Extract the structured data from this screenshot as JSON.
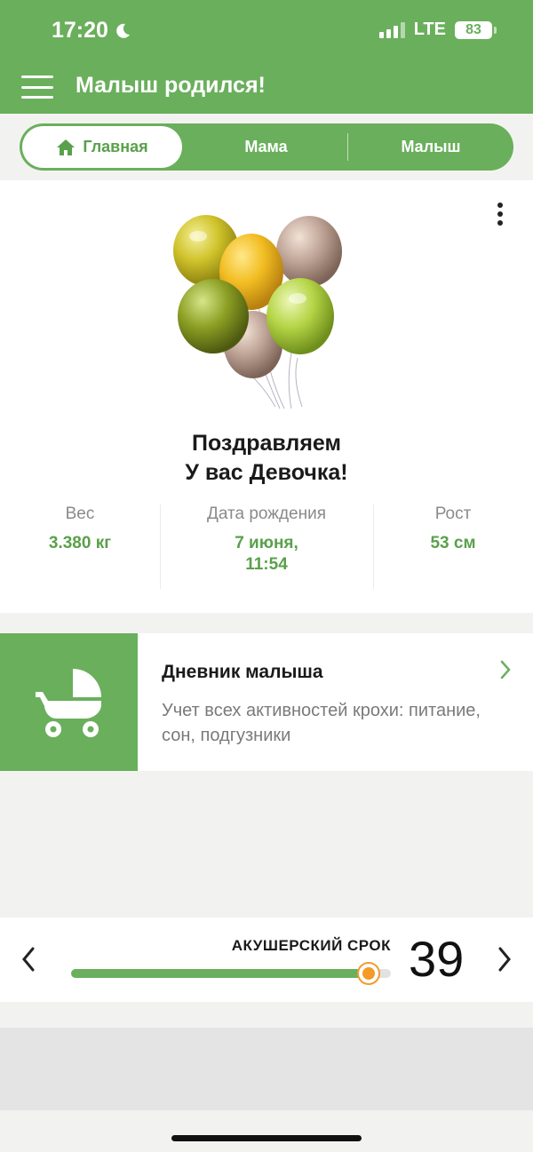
{
  "status": {
    "time": "17:20",
    "network": "LTE",
    "battery": "83"
  },
  "header": {
    "title": "Малыш родился!"
  },
  "tabs": [
    {
      "label": "Главная",
      "active": true
    },
    {
      "label": "Мама",
      "active": false
    },
    {
      "label": "Малыш",
      "active": false
    }
  ],
  "congrats": {
    "line1": "Поздравляем",
    "line2": "У вас Девочка!"
  },
  "stats": [
    {
      "label": "Вес",
      "value": "3.380 кг"
    },
    {
      "label": "Дата рождения",
      "value_line1": "7 июня,",
      "value_line2": "11:54"
    },
    {
      "label": "Рост",
      "value": "53 см"
    }
  ],
  "diary": {
    "title": "Дневник малыша",
    "description": "Учет всех активностей крохи: питание, сон, подгузники"
  },
  "term": {
    "label": "АКУШЕРСКИЙ СРОК",
    "week": "39",
    "progress": 0.93
  },
  "colors": {
    "accent": "#6aaf5c",
    "accent_dark": "#5aa04b",
    "thumb": "#f39a2b"
  }
}
